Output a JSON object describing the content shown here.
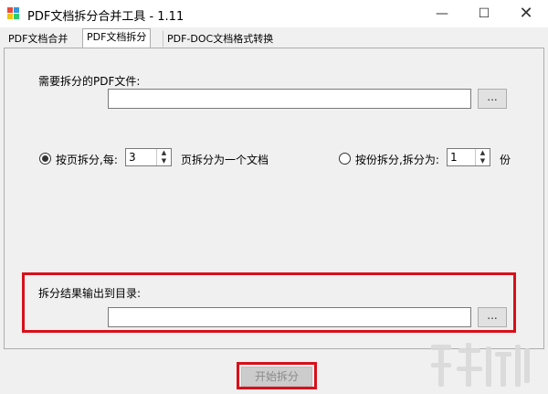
{
  "window": {
    "title": "PDF文档拆分合并工具 - 1.11",
    "minimize_glyph": "—",
    "maximize_glyph": "☐",
    "close_glyph": "✕"
  },
  "tabs": [
    {
      "label": "PDF文档合并",
      "active": false
    },
    {
      "label": "PDF文档拆分",
      "active": true
    },
    {
      "label": "PDF-DOC文档格式转换",
      "active": false
    }
  ],
  "split": {
    "input_label": "需要拆分的PDF文件:",
    "input_value": "",
    "browse_label": "...",
    "by_page_label": "按页拆分,每:",
    "by_page_value": "3",
    "by_page_suffix": "页拆分为一个文档",
    "by_count_label": "按份拆分,拆分为:",
    "by_count_value": "1",
    "by_count_suffix": "份",
    "selected_mode": "by_page",
    "output_label": "拆分结果输出到目录:",
    "output_value": "",
    "output_browse_label": "...",
    "start_label": "开始拆分"
  },
  "colors": {
    "highlight": "#d8101a",
    "icon_colors": [
      "#e74c3c",
      "#3498db",
      "#f1c40f",
      "#2ecc71"
    ]
  }
}
